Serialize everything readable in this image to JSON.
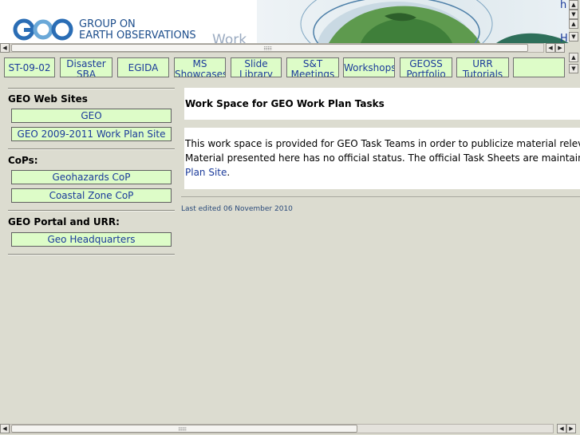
{
  "header": {
    "org_line1": "GROUP ON",
    "org_line2": "EARTH OBSERVATIONS",
    "banner_text": "Work",
    "link_top": "h",
    "link_bottom": "H"
  },
  "tabs": [
    {
      "label": "ST-09-02"
    },
    {
      "label": "Disaster SBA"
    },
    {
      "label": "EGIDA"
    },
    {
      "label": "MS Showcases"
    },
    {
      "label": "Slide Library"
    },
    {
      "label": "S&T Meetings"
    },
    {
      "label": "Workshops"
    },
    {
      "label": "GEOSS Portfolio"
    },
    {
      "label": "URR Tutorials"
    },
    {
      "label": ""
    }
  ],
  "sidebar": {
    "sections": [
      {
        "heading": "GEO Web Sites",
        "items": [
          "GEO",
          "GEO 2009-2011 Work Plan Site"
        ]
      },
      {
        "heading": "CoPs:",
        "items": [
          "Geohazards CoP",
          "Coastal Zone CoP"
        ]
      },
      {
        "heading": "GEO Portal and URR:",
        "items": [
          "Geo Headquarters"
        ]
      }
    ]
  },
  "main": {
    "title": "Work Space for GEO Work Plan Tasks",
    "desc_line1": "This work space is provided for GEO Task Teams in order to publicize material relevant fo",
    "desc_line2": "Material presented here has no official status. The official Task Sheets are maintained",
    "desc_link": "Plan Site",
    "desc_end": ".",
    "last_edited": "Last edited 06 November 2010"
  },
  "colors": {
    "background": "#dcdcd0",
    "button_fill": "#ddfcc8",
    "link": "#1a3a9a",
    "brand_blue": "#1d4e8c"
  }
}
